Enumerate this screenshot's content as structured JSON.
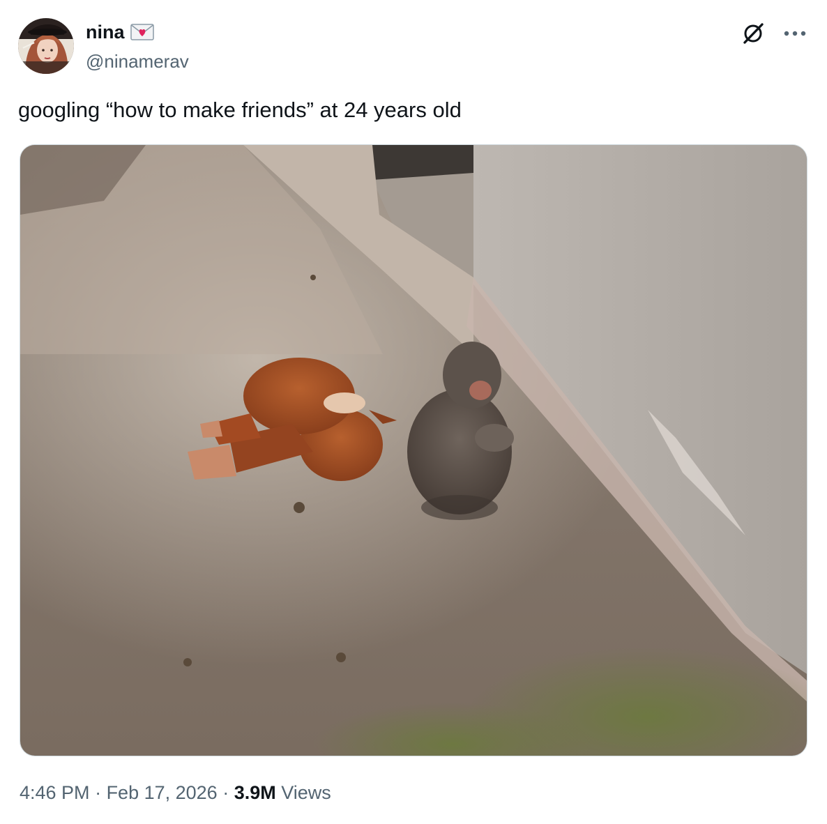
{
  "author": {
    "display_name": "nina",
    "handle": "@ninamerav",
    "badge_icon": "love-letter-icon"
  },
  "tweet": {
    "text": "googling “how to make friends” at 24 years old"
  },
  "meta": {
    "time": "4:46 PM",
    "separator_1": " · ",
    "date": "Feb 17, 2026",
    "separator_2": " · ",
    "views_count": "3.9M",
    "views_label": " Views"
  },
  "icons": {
    "grok": "grok-icon",
    "more": "more-options-icon"
  },
  "colors": {
    "text_primary": "#0f1419",
    "text_secondary": "#536471",
    "border": "#cfd9de"
  }
}
